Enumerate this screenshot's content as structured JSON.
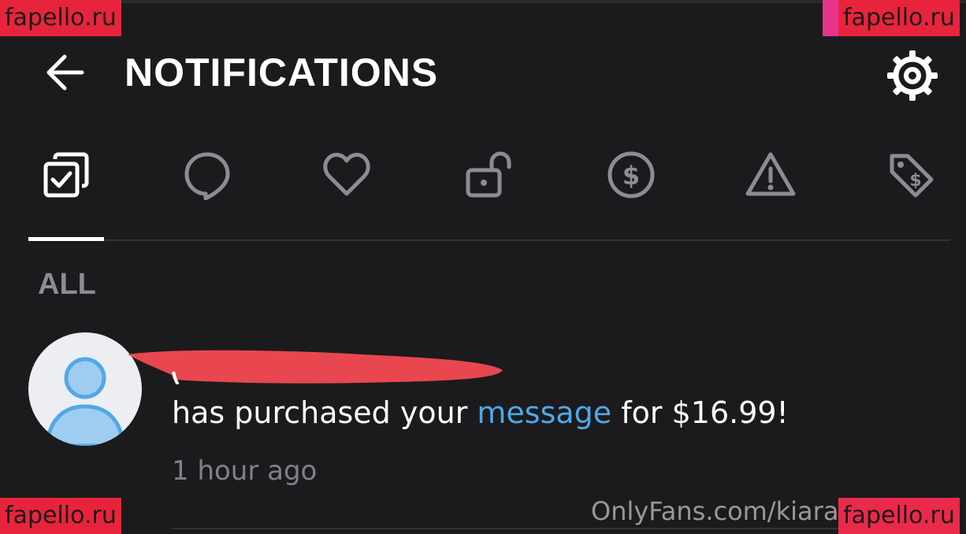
{
  "header": {
    "title": "NOTIFICATIONS",
    "back_icon": "arrow-left-icon",
    "settings_icon": "gear-icon"
  },
  "tabs": [
    {
      "icon": "checklist-icon",
      "active": true
    },
    {
      "icon": "comment-icon",
      "active": false
    },
    {
      "icon": "heart-icon",
      "active": false
    },
    {
      "icon": "unlock-icon",
      "active": false
    },
    {
      "icon": "dollar-circle-icon",
      "active": false
    },
    {
      "icon": "warning-icon",
      "active": false
    },
    {
      "icon": "price-tag-icon",
      "active": false
    }
  ],
  "section": {
    "label": "ALL"
  },
  "notifications": [
    {
      "avatar_icon": "default-user-icon",
      "text_before": "has purchased your ",
      "link_text": "message",
      "text_after": " for $16.99!",
      "time": "1 hour ago"
    }
  ],
  "watermarks": {
    "site": "OnlyFans.com/kiara",
    "badge_top_left": "fapello.ru",
    "badge_top_right": "fapello.ru",
    "badge_bottom_left": "fapello.ru",
    "badge_bottom_right": "fapello.ru"
  },
  "colors": {
    "background": "#1b1b1d",
    "text": "#ffffff",
    "muted": "#8a8d93",
    "link": "#4fa8e8",
    "redaction": "#e8474f",
    "badge": "#e8243c"
  }
}
